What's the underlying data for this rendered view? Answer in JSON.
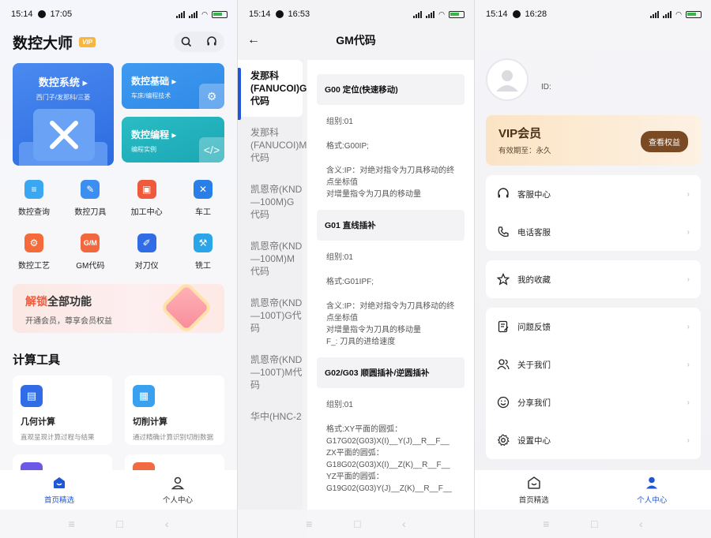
{
  "colors": {
    "accent": "#1f56d6",
    "vip_brown": "#7a4a24",
    "unlock_red": "#f05b3c"
  },
  "screen1": {
    "status": {
      "time": "15:14",
      "clock": "17:05"
    },
    "title": "数控大师",
    "vip_badge": "VIP",
    "cards": {
      "big": {
        "title": "数控系统",
        "subtitle": "西门子/发那科/三菱"
      },
      "basic": {
        "title": "数控基础",
        "subtitle": "车床/编程技术"
      },
      "programming": {
        "title": "数控编程",
        "subtitle": "编程实例"
      }
    },
    "grid": [
      {
        "label": "数控查询",
        "icon": "doc-icon",
        "color": "#39a8f0"
      },
      {
        "label": "数控刀具",
        "icon": "wrench-icon",
        "color": "#3c8ef0"
      },
      {
        "label": "加工中心",
        "icon": "machine-icon",
        "color": "#f05a3c"
      },
      {
        "label": "车工",
        "icon": "tools-icon",
        "color": "#2a7ee8"
      },
      {
        "label": "数控工艺",
        "icon": "gear-icon",
        "color": "#f46a3a"
      },
      {
        "label": "GM代码",
        "icon": "code-icon",
        "color": "#f2673d"
      },
      {
        "label": "对刀仪",
        "icon": "pen-icon",
        "color": "#2f6ce6"
      },
      {
        "label": "铣工",
        "icon": "mill-icon",
        "color": "#2aa6e8"
      }
    ],
    "unlock": {
      "title_hl": "解锁",
      "title_rest": "全部功能",
      "subtitle": "开通会员，尊享会员权益"
    },
    "section_title": "计算工具",
    "tools": [
      {
        "title": "几何计算",
        "subtitle": "直观呈现计算过程与结果",
        "color": "#2f6ce6"
      },
      {
        "title": "切削计算",
        "subtitle": "通过精确计算识别切削数据",
        "color": "#3aa0f0"
      }
    ],
    "tabs": [
      {
        "label": "首页精选"
      },
      {
        "label": "个人中心"
      }
    ]
  },
  "screen2": {
    "status": {
      "time": "15:14",
      "clock": "16:53"
    },
    "title": "GM代码",
    "categories": [
      "发那科(FANUCOI)G代码",
      "发那科(FANUCOI)M代码",
      "凯恩帝(KND—100M)G代码",
      "凯恩帝(KND—100M)M代码",
      "凯恩帝(KND—100T)G代码",
      "凯恩帝(KND—100T)M代码",
      "华中(HNC-2"
    ],
    "codes": [
      {
        "head": "G00 定位(快速移动)",
        "group": "组别:01",
        "format": "格式:G00IP;",
        "meaning": [
          "含义:IP：对绝对指令为刀具移动的终点坐标值",
          "对增量指令为刀具的移动量"
        ]
      },
      {
        "head": "G01 直线插补",
        "group": "组别:01",
        "format": "格式:G01IPF;",
        "meaning": [
          "含义:IP：对绝对指令为刀具移动的终点坐标值",
          "对增量指令为刀具的移动量",
          "F_: 刀具的进给速度"
        ]
      },
      {
        "head": "G02/G03 顺圆插补/逆圆插补",
        "group": "组别:01",
        "format": "格式:XY平面的圆弧：G17G02(G03)X(I)__Y(J)__R__F__",
        "meaning": [
          "ZX平面的圆弧：G18G02(G03)X(I)__Z(K)__R__F__",
          "YZ平面的圆弧：G19G02(G03)Y(J)__Z(K)__R__F__"
        ]
      }
    ]
  },
  "screen3": {
    "status": {
      "time": "15:14",
      "clock": "16:28"
    },
    "id_label": "ID:",
    "vip": {
      "title": "VIP会员",
      "subtitle": "有效期至：永久",
      "button": "查看权益"
    },
    "group1": [
      {
        "label": "客服中心",
        "icon": "headset-icon"
      },
      {
        "label": "电话客服",
        "icon": "phone-icon"
      }
    ],
    "group2": [
      {
        "label": "我的收藏",
        "icon": "star-icon"
      }
    ],
    "group3": [
      {
        "label": "问题反馈",
        "icon": "feedback-icon"
      },
      {
        "label": "关于我们",
        "icon": "users-icon"
      },
      {
        "label": "分享我们",
        "icon": "smile-icon"
      },
      {
        "label": "设置中心",
        "icon": "gear-icon"
      }
    ],
    "tabs": [
      {
        "label": "首页精选"
      },
      {
        "label": "个人中心"
      }
    ],
    "chevron": "›"
  },
  "sysnav": [
    "≡",
    "□",
    "‹"
  ]
}
